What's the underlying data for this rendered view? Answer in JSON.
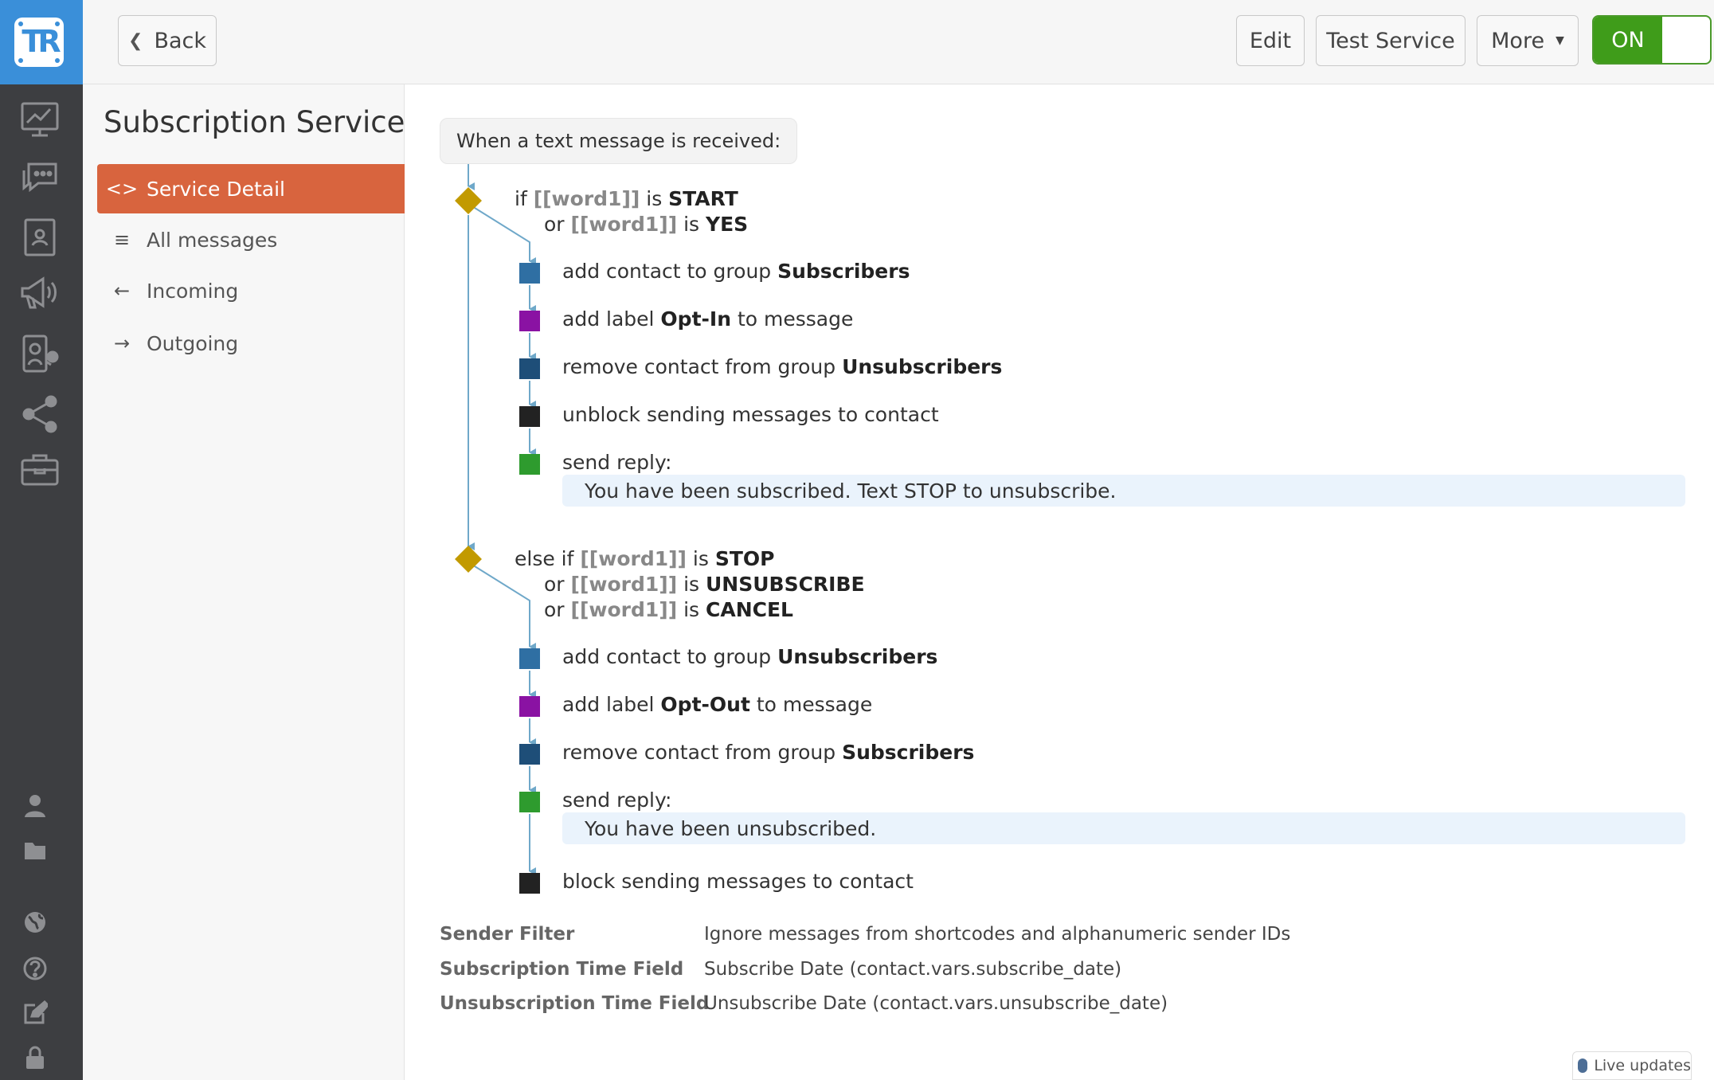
{
  "toolbar": {
    "back_label": "Back",
    "edit_label": "Edit",
    "test_label": "Test Service",
    "more_label": "More",
    "toggle_label": "ON"
  },
  "brand": {
    "logo_text": "TR",
    "accent": "#3a8fd9"
  },
  "rail": {
    "icons": [
      "dashboard-icon",
      "messages-icon",
      "contacts-icon",
      "broadcast-icon",
      "services-icon",
      "share-icon",
      "toolbox-icon",
      "user-icon",
      "folder-icon",
      "globe-icon",
      "help-icon",
      "edit-icon",
      "lock-icon"
    ]
  },
  "sidenav": {
    "title": "Subscription Service",
    "items": [
      {
        "label": "Service Detail",
        "icon": "code-icon",
        "active": true
      },
      {
        "label": "All messages",
        "icon": "list-icon"
      },
      {
        "label": "Incoming",
        "icon": "arrow-left-icon"
      },
      {
        "label": "Outgoing",
        "icon": "arrow-right-icon"
      }
    ],
    "active_color": "#d8643e"
  },
  "flow": {
    "trigger": "When a text message is received:",
    "branch1": {
      "line1": {
        "prefix": "if ",
        "var": "[[word1]]",
        "op": " is ",
        "value": "START"
      },
      "line2": {
        "prefix": "or ",
        "var": "[[word1]]",
        "op": " is ",
        "value": "YES"
      },
      "steps": [
        {
          "pre": "add contact to group ",
          "bold": "Subscribers",
          "post": "",
          "color": "#2f6fa3"
        },
        {
          "pre": "add label ",
          "bold": "Opt-In",
          "post": " to message",
          "color": "#8a12a3"
        },
        {
          "pre": "remove contact from group ",
          "bold": "Unsubscribers",
          "post": "",
          "color": "#1e4e78"
        },
        {
          "pre": "unblock sending messages to contact",
          "bold": "",
          "post": "",
          "color": "#222222"
        },
        {
          "pre": "send reply:",
          "bold": "",
          "post": "",
          "color": "#2e9b2e"
        }
      ],
      "reply": "You have been subscribed. Text STOP to unsubscribe."
    },
    "branch2": {
      "line1": {
        "prefix": "else if ",
        "var": "[[word1]]",
        "op": " is ",
        "value": "STOP"
      },
      "line2": {
        "prefix": "or ",
        "var": "[[word1]]",
        "op": " is ",
        "value": "UNSUBSCRIBE"
      },
      "line3": {
        "prefix": "or ",
        "var": "[[word1]]",
        "op": " is ",
        "value": "CANCEL"
      },
      "steps": [
        {
          "pre": "add contact to group ",
          "bold": "Unsubscribers",
          "post": "",
          "color": "#2f6fa3"
        },
        {
          "pre": "add label ",
          "bold": "Opt-Out",
          "post": " to message",
          "color": "#8a12a3"
        },
        {
          "pre": "remove contact from group ",
          "bold": "Subscribers",
          "post": "",
          "color": "#1e4e78"
        },
        {
          "pre": "send reply:",
          "bold": "",
          "post": "",
          "color": "#2e9b2e"
        },
        {
          "pre": "block sending messages to contact",
          "bold": "",
          "post": "",
          "color": "#222222"
        }
      ],
      "reply": "You have been unsubscribed."
    },
    "diamond_color": "#c29a00",
    "line_color": "#6fa8c9"
  },
  "meta": [
    {
      "label": "Sender Filter",
      "value": "Ignore messages from shortcodes and alphanumeric sender IDs"
    },
    {
      "label": "Subscription Time Field",
      "value": "Subscribe Date (contact.vars.subscribe_date)"
    },
    {
      "label": "Unsubscription Time Field",
      "value": "Unsubscribe Date (contact.vars.unsubscribe_date)"
    }
  ],
  "footer": {
    "live_label": "Live updates"
  }
}
